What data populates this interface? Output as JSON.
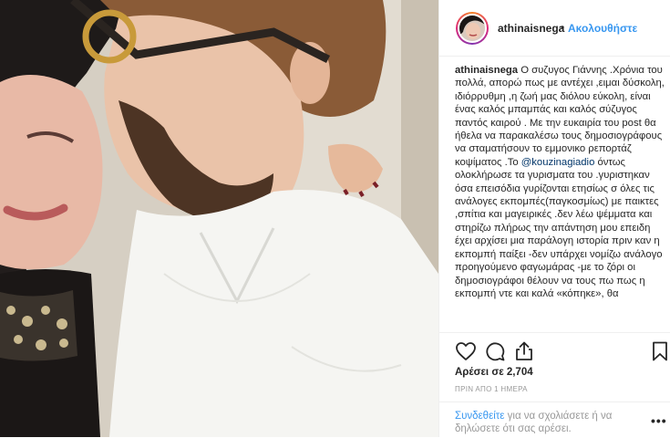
{
  "photo": {
    "alt": ""
  },
  "header": {
    "username": "athinaisnega",
    "dot": "•",
    "follow_label": "Ακολουθήστε"
  },
  "caption": {
    "username": "athinaisnega",
    "text_before_mention": " Ο συζυγος Γιάννης .Χρόνια του πολλά, απορώ πως με αντέχει ,ειμαι δύσκολη, ιδιόρρυθμη ,η ζωή μας διόλου εύκολη, είναι ένας καλός μπαμπάς και καλός σύζυγος παντός καιρού . Με την ευκαιρία του post θα ήθελα να παρακαλέσω τους δημοσιογράφους να σταματήσουν το εμμονικο ρεπορτάζ κοψίματος .Το ",
    "mention": "@kouzinagiadio",
    "text_after_mention": " όντως ολοκλήρωσε τα γυρισματα του .γυριστηκαν όσα επεισόδια γυρίζονται ετησίως σ όλες τις ανάλογες εκπομπές(παγκοσμίως) με παικτες ,σπίτια και μαγειρικές .δεν λέω ψέμματα και στηρίζω πλήρως την απάντηση μου επειδη έχει αρχίσει μια παράλογη ιστορία πριν καν η εκπομπή παίξει -δεν υπάρχει νομίζω ανάλογο προηγούμενο φαγωμάρας -με το ζόρι οι δημοσιογράφοι θέλουν να τους πω πως η εκπομπή ντε και καλά «κόπηκε», θα"
  },
  "actions": {
    "like_icon": "heart-icon",
    "comment_icon": "comment-icon",
    "share_icon": "share-icon",
    "save_icon": "bookmark-icon"
  },
  "likes": {
    "label": "Αρέσει σε 2,704"
  },
  "timestamp": "ΠΡΙΝ ΑΠΟ 1 ΗΜΕΡΑ",
  "login_prompt": {
    "link": "Συνδεθείτε",
    "text": " για να σχολιάσετε ή να δηλώσετε ότι σας αρέσει."
  },
  "more_options": "•••",
  "colors": {
    "link_blue": "#3897f0",
    "mention_blue": "#003569",
    "text": "#262626",
    "muted": "#999999",
    "border": "#efefef"
  }
}
